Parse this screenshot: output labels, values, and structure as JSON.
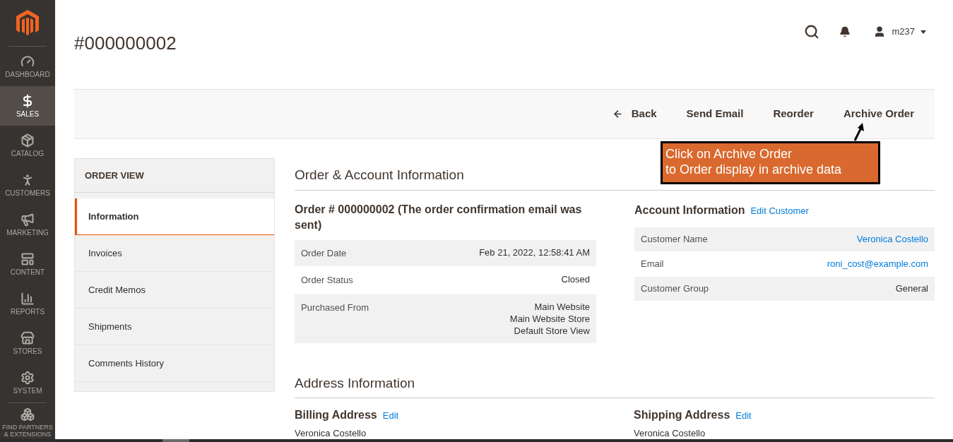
{
  "sidebar": {
    "items": [
      {
        "label": "DASHBOARD",
        "kind": "dashboard",
        "selected": false
      },
      {
        "label": "SALES",
        "kind": "sales",
        "selected": true
      },
      {
        "label": "CATALOG",
        "kind": "catalog",
        "selected": false
      },
      {
        "label": "CUSTOMERS",
        "kind": "customers",
        "selected": false
      },
      {
        "label": "MARKETING",
        "kind": "marketing",
        "selected": false
      },
      {
        "label": "CONTENT",
        "kind": "content",
        "selected": false
      },
      {
        "label": "REPORTS",
        "kind": "reports",
        "selected": false
      },
      {
        "label": "STORES",
        "kind": "stores",
        "selected": false
      },
      {
        "label": "SYSTEM",
        "kind": "system",
        "selected": false
      },
      {
        "label": "FIND PARTNERS & EXTENSIONS",
        "kind": "partners",
        "selected": false
      }
    ]
  },
  "header": {
    "title": "#000000002",
    "user": "m237"
  },
  "toolbar": {
    "buttons": [
      {
        "label": "Back",
        "kind": "back"
      },
      {
        "label": "Send Email",
        "kind": "plain"
      },
      {
        "label": "Reorder",
        "kind": "plain"
      },
      {
        "label": "Archive Order",
        "kind": "plain"
      }
    ]
  },
  "callout": {
    "lines": [
      "Click on Archive Order",
      "to Order display in archive data"
    ]
  },
  "order_view": {
    "title": "ORDER VIEW",
    "tabs": [
      {
        "label": "Information",
        "selected": true
      },
      {
        "label": "Invoices",
        "selected": false
      },
      {
        "label": "Credit Memos",
        "selected": false
      },
      {
        "label": "Shipments",
        "selected": false
      },
      {
        "label": "Comments History",
        "selected": false
      }
    ]
  },
  "order_account": {
    "title": "Order & Account Information",
    "order": {
      "title": "Order # 000000002 (The order confirmation email was sent)",
      "rows": [
        {
          "label": "Order Date",
          "value": [
            "Feb 21, 2022, 12:58:41 AM"
          ]
        },
        {
          "label": "Order Status",
          "value": [
            "Closed"
          ]
        },
        {
          "label": "Purchased From",
          "value": [
            "Main Website",
            "Main Website Store",
            "Default Store View"
          ]
        }
      ]
    },
    "account": {
      "title": "Account Information",
      "edit": "Edit Customer",
      "rows": [
        {
          "label": "Customer Name",
          "value": "Veronica Costello",
          "link": true
        },
        {
          "label": "Email",
          "value": "roni_cost@example.com",
          "link": true
        },
        {
          "label": "Customer Group",
          "value": "General",
          "link": false
        }
      ]
    }
  },
  "address": {
    "title": "Address Information",
    "blocks": [
      {
        "title": "Billing Address",
        "edit": "Edit",
        "name": "Veronica Costello"
      },
      {
        "title": "Shipping Address",
        "edit": "Edit",
        "name": "Veronica Costello"
      }
    ]
  }
}
